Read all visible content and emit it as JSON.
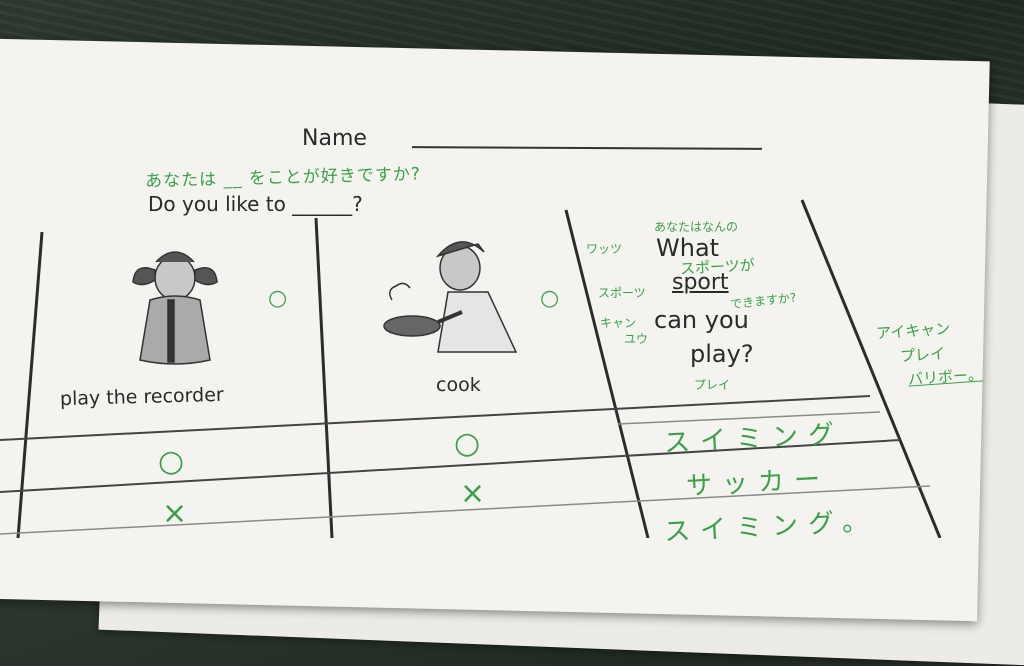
{
  "worksheet": {
    "name_label": "Name",
    "question_jp": "あなたは __ をことが好きですか?",
    "question_en": "Do you like to ______?",
    "activities": [
      {
        "label": "play the recorder",
        "icon": "girl-playing-recorder-icon",
        "mark": "○"
      },
      {
        "label": "cook",
        "icon": "boy-cooking-icon",
        "mark": "○"
      }
    ],
    "sport_question": {
      "what": "What",
      "sport": "sport",
      "can_you": "can you",
      "play": "play?"
    },
    "annotations": {
      "what_jp_top": "あなたはなんの",
      "what_kana": "ワッツ",
      "sport_ga": "スポーツが",
      "sport_kana": "スポーツ",
      "dekimasuka": "できますか?",
      "can_kana_1": "キャン",
      "can_kana_2": "ユウ",
      "play_kana": "プレイ",
      "side_1": "アイキャン",
      "side_2": "プレイ",
      "side_3": "バリボー。"
    },
    "answers": [
      {
        "col1": "○",
        "col2": "○",
        "sport": "スイミング"
      },
      {
        "col1": "×",
        "col2": "×",
        "sport": "サッカー"
      },
      {
        "col1": "",
        "col2": "",
        "sport": "スイミング。"
      }
    ],
    "colors": {
      "ink": "#2a2a2a",
      "green_pen": "#3aa14a",
      "paper": "#f4f3ef"
    }
  }
}
